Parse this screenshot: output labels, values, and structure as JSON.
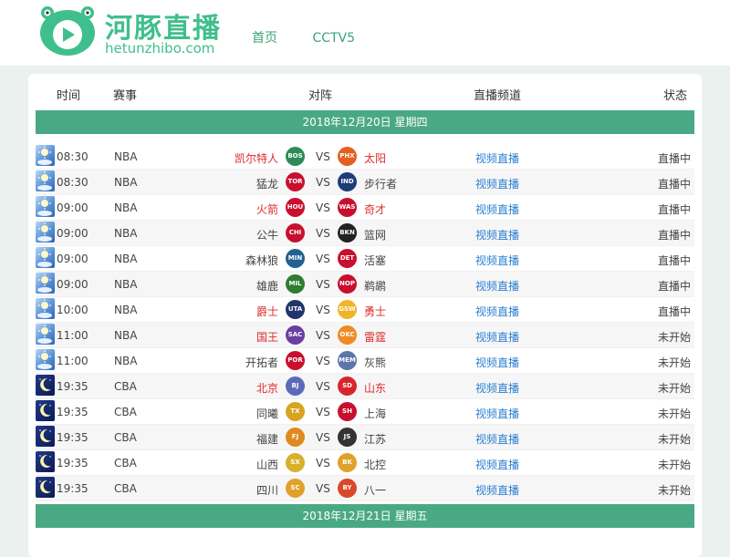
{
  "site": {
    "logo_cn": "河豚直播",
    "logo_en": "hetunzhibo.com",
    "nav": [
      "首页",
      "CCTV5"
    ]
  },
  "table": {
    "headers": {
      "time": "时间",
      "league": "赛事",
      "match": "对阵",
      "channel": "直播频道",
      "status": "状态"
    }
  },
  "dates": [
    "2018年12月20日 星期四",
    "2018年12月21日 星期五"
  ],
  "vs": "VS",
  "colors": {
    "brand": "#3fbf8d",
    "date_bar": "#4aa985",
    "link": "#2a7fd0",
    "highlight": "#e02b2b"
  },
  "games": [
    {
      "time": "08:30",
      "league": "NBA",
      "home": "凯尔特人",
      "home_abbr": "BOS",
      "home_color": "#2e8b57",
      "away": "太阳",
      "away_abbr": "PHX",
      "away_color": "#e56020",
      "channel": "视频直播",
      "status": "直播中",
      "red": true,
      "icon": "day"
    },
    {
      "time": "08:30",
      "league": "NBA",
      "home": "猛龙",
      "home_abbr": "TOR",
      "home_color": "#c8102e",
      "away": "步行者",
      "away_abbr": "IND",
      "away_color": "#1d3c78",
      "channel": "视频直播",
      "status": "直播中",
      "red": false,
      "icon": "day"
    },
    {
      "time": "09:00",
      "league": "NBA",
      "home": "火箭",
      "home_abbr": "HOU",
      "home_color": "#c8102e",
      "away": "奇才",
      "away_abbr": "WAS",
      "away_color": "#c8102e",
      "channel": "视频直播",
      "status": "直播中",
      "red": true,
      "icon": "day"
    },
    {
      "time": "09:00",
      "league": "NBA",
      "home": "公牛",
      "home_abbr": "CHI",
      "home_color": "#c8102e",
      "away": "篮网",
      "away_abbr": "BKN",
      "away_color": "#222222",
      "channel": "视频直播",
      "status": "直播中",
      "red": false,
      "icon": "day"
    },
    {
      "time": "09:00",
      "league": "NBA",
      "home": "森林狼",
      "home_abbr": "MIN",
      "home_color": "#236192",
      "away": "活塞",
      "away_abbr": "DET",
      "away_color": "#c8102e",
      "channel": "视频直播",
      "status": "直播中",
      "red": false,
      "icon": "day"
    },
    {
      "time": "09:00",
      "league": "NBA",
      "home": "雄鹿",
      "home_abbr": "MIL",
      "home_color": "#2e7d32",
      "away": "鹈鹕",
      "away_abbr": "NOP",
      "away_color": "#c8102e",
      "channel": "视频直播",
      "status": "直播中",
      "red": false,
      "icon": "day"
    },
    {
      "time": "10:00",
      "league": "NBA",
      "home": "爵士",
      "home_abbr": "UTA",
      "home_color": "#23336b",
      "away": "勇士",
      "away_abbr": "GSW",
      "away_color": "#f0b429",
      "channel": "视频直播",
      "status": "直播中",
      "red": true,
      "icon": "day"
    },
    {
      "time": "11:00",
      "league": "NBA",
      "home": "国王",
      "home_abbr": "SAC",
      "home_color": "#6a3fa0",
      "away": "雷霆",
      "away_abbr": "OKC",
      "away_color": "#f08a24",
      "channel": "视频直播",
      "status": "未开始",
      "red": true,
      "icon": "day"
    },
    {
      "time": "11:00",
      "league": "NBA",
      "home": "开拓者",
      "home_abbr": "POR",
      "home_color": "#c8102e",
      "away": "灰熊",
      "away_abbr": "MEM",
      "away_color": "#5d76a9",
      "channel": "视频直播",
      "status": "未开始",
      "red": false,
      "icon": "day"
    },
    {
      "time": "19:35",
      "league": "CBA",
      "home": "北京",
      "home_abbr": "BJ",
      "home_color": "#5b6bb8",
      "away": "山东",
      "away_abbr": "SD",
      "away_color": "#d7262b",
      "channel": "视频直播",
      "status": "未开始",
      "red": true,
      "icon": "night"
    },
    {
      "time": "19:35",
      "league": "CBA",
      "home": "同曦",
      "home_abbr": "TX",
      "home_color": "#d9a41e",
      "away": "上海",
      "away_abbr": "SH",
      "away_color": "#c8102e",
      "channel": "视频直播",
      "status": "未开始",
      "red": false,
      "icon": "night"
    },
    {
      "time": "19:35",
      "league": "CBA",
      "home": "福建",
      "home_abbr": "FJ",
      "home_color": "#e08a1e",
      "away": "江苏",
      "away_abbr": "JS",
      "away_color": "#333333",
      "channel": "视频直播",
      "status": "未开始",
      "red": false,
      "icon": "night"
    },
    {
      "time": "19:35",
      "league": "CBA",
      "home": "山西",
      "home_abbr": "SX",
      "home_color": "#d8b02a",
      "away": "北控",
      "away_abbr": "BK",
      "away_color": "#e0a12a",
      "channel": "视频直播",
      "status": "未开始",
      "red": false,
      "icon": "night"
    },
    {
      "time": "19:35",
      "league": "CBA",
      "home": "四川",
      "home_abbr": "SC",
      "home_color": "#e0a12a",
      "away": "八一",
      "away_abbr": "BY",
      "away_color": "#d9482a",
      "channel": "视频直播",
      "status": "未开始",
      "red": false,
      "icon": "night"
    }
  ]
}
